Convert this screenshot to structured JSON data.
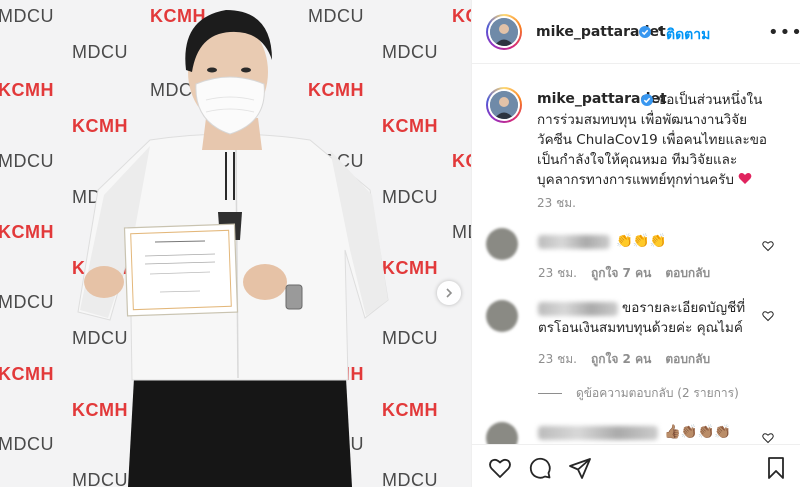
{
  "backdrop": {
    "brand_a": "MDCU",
    "brand_b": "KCMH"
  },
  "colors": {
    "accent_blue": "#0095f6",
    "kcmh_red": "#e2393a",
    "muted": "#8e8e8e",
    "text": "#262626"
  },
  "header": {
    "username": "mike_pattaradet",
    "dot": "•",
    "follow_label": "ติดตาม",
    "more_icon": "•••"
  },
  "caption": {
    "username": "mike_pattaradet",
    "lines": [
      "ขอเป็นส่วนหนึ่งใน",
      "การร่วมสมทบทุน เพื่อพัฒนางานวิจัย",
      "วัคซีน ChulaCov19 เพื่อคนไทยและขอ",
      "เป็นกำลังใจให้คุณหมอ ทีมวิจัยและ",
      "บุคลากรทางการแพทย์ทุกท่านครับ"
    ],
    "time": "23 ชม."
  },
  "comments": [
    {
      "text": "👏👏👏",
      "time": "23 ชม.",
      "likes": "ถูกใจ 7 คน",
      "reply_label": "ตอบกลับ"
    },
    {
      "text_line1": "ขอรายละเอียดบัญชีที่",
      "text_line2": "ตรโอนเงินสมทบทุนด้วยค่ะ คุณไมค์",
      "time": "23 ชม.",
      "likes": "ถูกใจ 2 คน",
      "reply_label": "ตอบกลับ",
      "view_replies": "ดูข้อความตอบกลับ (2 รายการ)"
    },
    {
      "text": "👍🏽👏🏽👏🏽👏🏽"
    }
  ],
  "actions": [
    "heart-outline-icon",
    "comment-icon",
    "share-icon",
    "bookmark-icon"
  ]
}
